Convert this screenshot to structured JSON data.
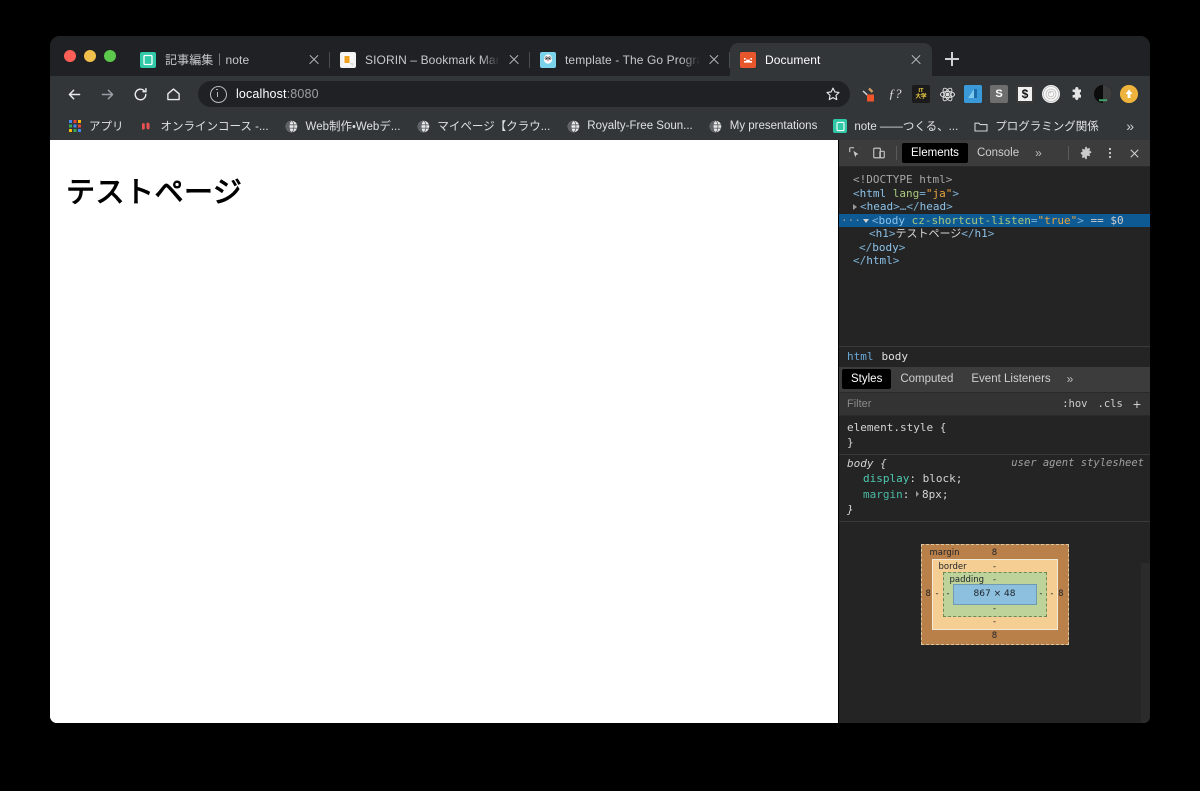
{
  "window": {
    "traffic_lights": [
      "close",
      "minimize",
      "zoom"
    ]
  },
  "tabs": [
    {
      "title": "記事編集｜note",
      "favicon": "note-icon",
      "active": false,
      "close_label": "×"
    },
    {
      "title": "SIORIN – Bookmark Manager –",
      "favicon": "siorin-icon",
      "active": false,
      "close_label": "×"
    },
    {
      "title": "template - The Go Programming",
      "favicon": "go-gopher-icon",
      "active": false,
      "close_label": "×"
    },
    {
      "title": "Document",
      "favicon": "document-orange-icon",
      "active": true,
      "close_label": "×"
    }
  ],
  "new_tab_label": "+",
  "nav": {
    "back": "back-arrow",
    "forward": "forward-arrow",
    "reload": "reload-icon",
    "home": "home-icon",
    "url_prefix": "localhost",
    "url_suffix": ":8080",
    "url_full": "localhost:8080",
    "site_info_icon": "info-circle-icon",
    "bookmark_star": "star-icon"
  },
  "extensions": [
    {
      "name": "hammer-extension",
      "glyph": "🔨"
    },
    {
      "name": "function-extension",
      "glyph": "ƒ?"
    },
    {
      "name": "it-daigaku-extension",
      "glyph": "IT大学"
    },
    {
      "name": "atom-extension",
      "glyph": "⚛"
    },
    {
      "name": "blue-extension",
      "glyph": "◪"
    },
    {
      "name": "s-extension",
      "glyph": "S"
    },
    {
      "name": "dollar-extension",
      "glyph": "$"
    },
    {
      "name": "target-extension",
      "glyph": "◎"
    },
    {
      "name": "puzzle-extension",
      "glyph": "🧩"
    },
    {
      "name": "profile-avatar",
      "glyph": ""
    },
    {
      "name": "update-extension",
      "glyph": "↑"
    }
  ],
  "bookmarks": {
    "items": [
      {
        "label": "アプリ",
        "favicon": "apps-grid-icon"
      },
      {
        "label": "オンラインコース -...",
        "favicon": "udemy-icon"
      },
      {
        "label": "Web制作・Webデ...",
        "favicon": "globe-icon"
      },
      {
        "label": "マイページ【クラウ...",
        "favicon": "globe-icon"
      },
      {
        "label": "Royalty-Free Soun...",
        "favicon": "globe-icon"
      },
      {
        "label": "My presentations",
        "favicon": "globe-icon"
      },
      {
        "label": "note ——つくる、...",
        "favicon": "note-icon"
      },
      {
        "label": "プログラミング関係",
        "favicon": "folder-icon"
      }
    ],
    "overflow_label": "»"
  },
  "page": {
    "heading": "テストページ"
  },
  "devtools": {
    "toolbar": {
      "inspect_icon": "inspect-element-icon",
      "device_icon": "device-toggle-icon",
      "tabs": [
        {
          "label": "Elements",
          "selected": true
        },
        {
          "label": "Console",
          "selected": false
        }
      ],
      "more_tabs_label": "»",
      "settings_icon": "gear-icon",
      "kebab_icon": "more-vertical-icon",
      "close_icon": "close-icon"
    },
    "elements_tree": [
      {
        "text": "<!DOCTYPE html>",
        "type": "doctype",
        "indent": 0
      },
      {
        "text": "<html lang=\"ja\">",
        "type": "tag",
        "indent": 0,
        "tagname": "html",
        "attr": "lang",
        "value": "ja"
      },
      {
        "text": "<head>…</head>",
        "type": "collapsed",
        "indent": 1,
        "tagname": "head"
      },
      {
        "text": "<body cz-shortcut-listen=\"true\"> == $0",
        "type": "selected",
        "indent": 1,
        "tagname": "body",
        "attr": "cz-shortcut-listen",
        "value": "true",
        "suffix": "== $0",
        "badge": "···"
      },
      {
        "text": "<h1>テストページ</h1>",
        "type": "child",
        "indent": 2,
        "tagname": "h1",
        "content": "テストページ"
      },
      {
        "text": "</body>",
        "type": "close",
        "indent": 1
      },
      {
        "text": "</html>",
        "type": "close",
        "indent": 0
      }
    ],
    "breadcrumb": [
      "html",
      "body"
    ],
    "styles_tabs": [
      {
        "label": "Styles",
        "selected": true
      },
      {
        "label": "Computed",
        "selected": false
      },
      {
        "label": "Event Listeners",
        "selected": false
      }
    ],
    "styles_more_label": "»",
    "filter": {
      "placeholder": "Filter",
      "hov_label": ":hov",
      "cls_label": ".cls",
      "new_rule_label": "+"
    },
    "css_rules": [
      {
        "selector": "element.style",
        "origin": "",
        "italic": false,
        "declarations": []
      },
      {
        "selector": "body",
        "origin": "user agent stylesheet",
        "italic": true,
        "declarations": [
          {
            "property": "display",
            "value": "block",
            "expandable": false
          },
          {
            "property": "margin",
            "value": "8px",
            "expandable": true
          }
        ]
      }
    ],
    "box_model": {
      "margin_label": "margin",
      "margin_top": "8",
      "margin_right": "8",
      "margin_bottom": "8",
      "margin_left": "8",
      "border_label": "border",
      "border_top": "-",
      "border_right": "-",
      "border_bottom": "-",
      "border_left": "-",
      "padding_label": "padding",
      "padding_top": "-",
      "padding_right": "-",
      "padding_bottom": "-",
      "padding_left": "-",
      "content_size": "867 × 48"
    }
  },
  "colors": {
    "chrome_frame": "#323639",
    "tab_strip": "#202124",
    "omnibox_bg": "#202124",
    "devtools_bg": "#242424",
    "devtools_toolbar": "#3c3c3c",
    "selected_row": "#0d5a94",
    "accent_green": "#4ec9b0",
    "attr_orange": "#e8a33d",
    "tag_blue": "#8cc2e8",
    "box_margin": "#b9804a",
    "box_border": "#f5ce93",
    "box_padding": "#bdd39a",
    "box_content": "#8cc0de"
  }
}
